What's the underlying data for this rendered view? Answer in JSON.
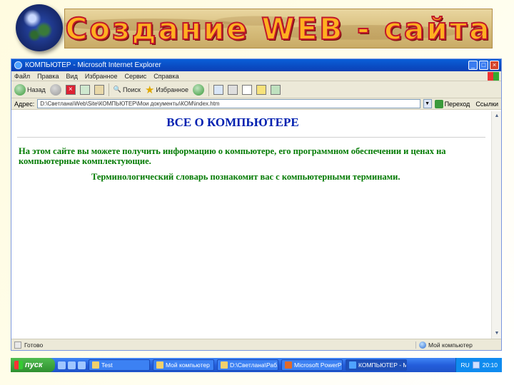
{
  "slide": {
    "title": "Создание WEB - сайта"
  },
  "window": {
    "title": "КОМПЬЮТЕР - Microsoft Internet Explorer",
    "controls": {
      "minimize": "_",
      "maximize": "□",
      "close": "×"
    }
  },
  "menu": [
    "Файл",
    "Правка",
    "Вид",
    "Избранное",
    "Сервис",
    "Справка"
  ],
  "toolbar": {
    "back_label": "Назад",
    "search_label": "Поиск",
    "favorites_label": "Избранное"
  },
  "addressbar": {
    "label": "Адрес:",
    "url": "D:\\Светлана\\Web\\Site\\КОМПЬЮТЕР\\Мои документы\\КОМ\\index.htm",
    "go_label": "Переход",
    "links_label": "Ссылки"
  },
  "page": {
    "heading": "ВСЕ О КОМПЬЮТЕРЕ",
    "intro": "На этом сайте вы можете получить информацию о компьютере, его программном обеспечении и ценах на компьютерные комплектующие.",
    "glossary": "Терминологический словарь познакомит вас с компьютерными терминами."
  },
  "statusbar": {
    "status": "Готово",
    "zone": "Мой компьютер"
  },
  "taskbar": {
    "start_label": "пуск",
    "tasks": [
      {
        "label": "Test"
      },
      {
        "label": "Мой компьютер"
      },
      {
        "label": "D:\\Светлана\\Раб..."
      },
      {
        "label": "Microsoft PowerPo..."
      },
      {
        "label": "КОМПЬЮТЕР - Mi..."
      }
    ],
    "lang": "RU",
    "clock": "20:10"
  },
  "colors": {
    "heading": "#0020b0",
    "body_text": "#007a00",
    "xp_blue": "#245edb",
    "start_green": "#3a9a3a"
  }
}
